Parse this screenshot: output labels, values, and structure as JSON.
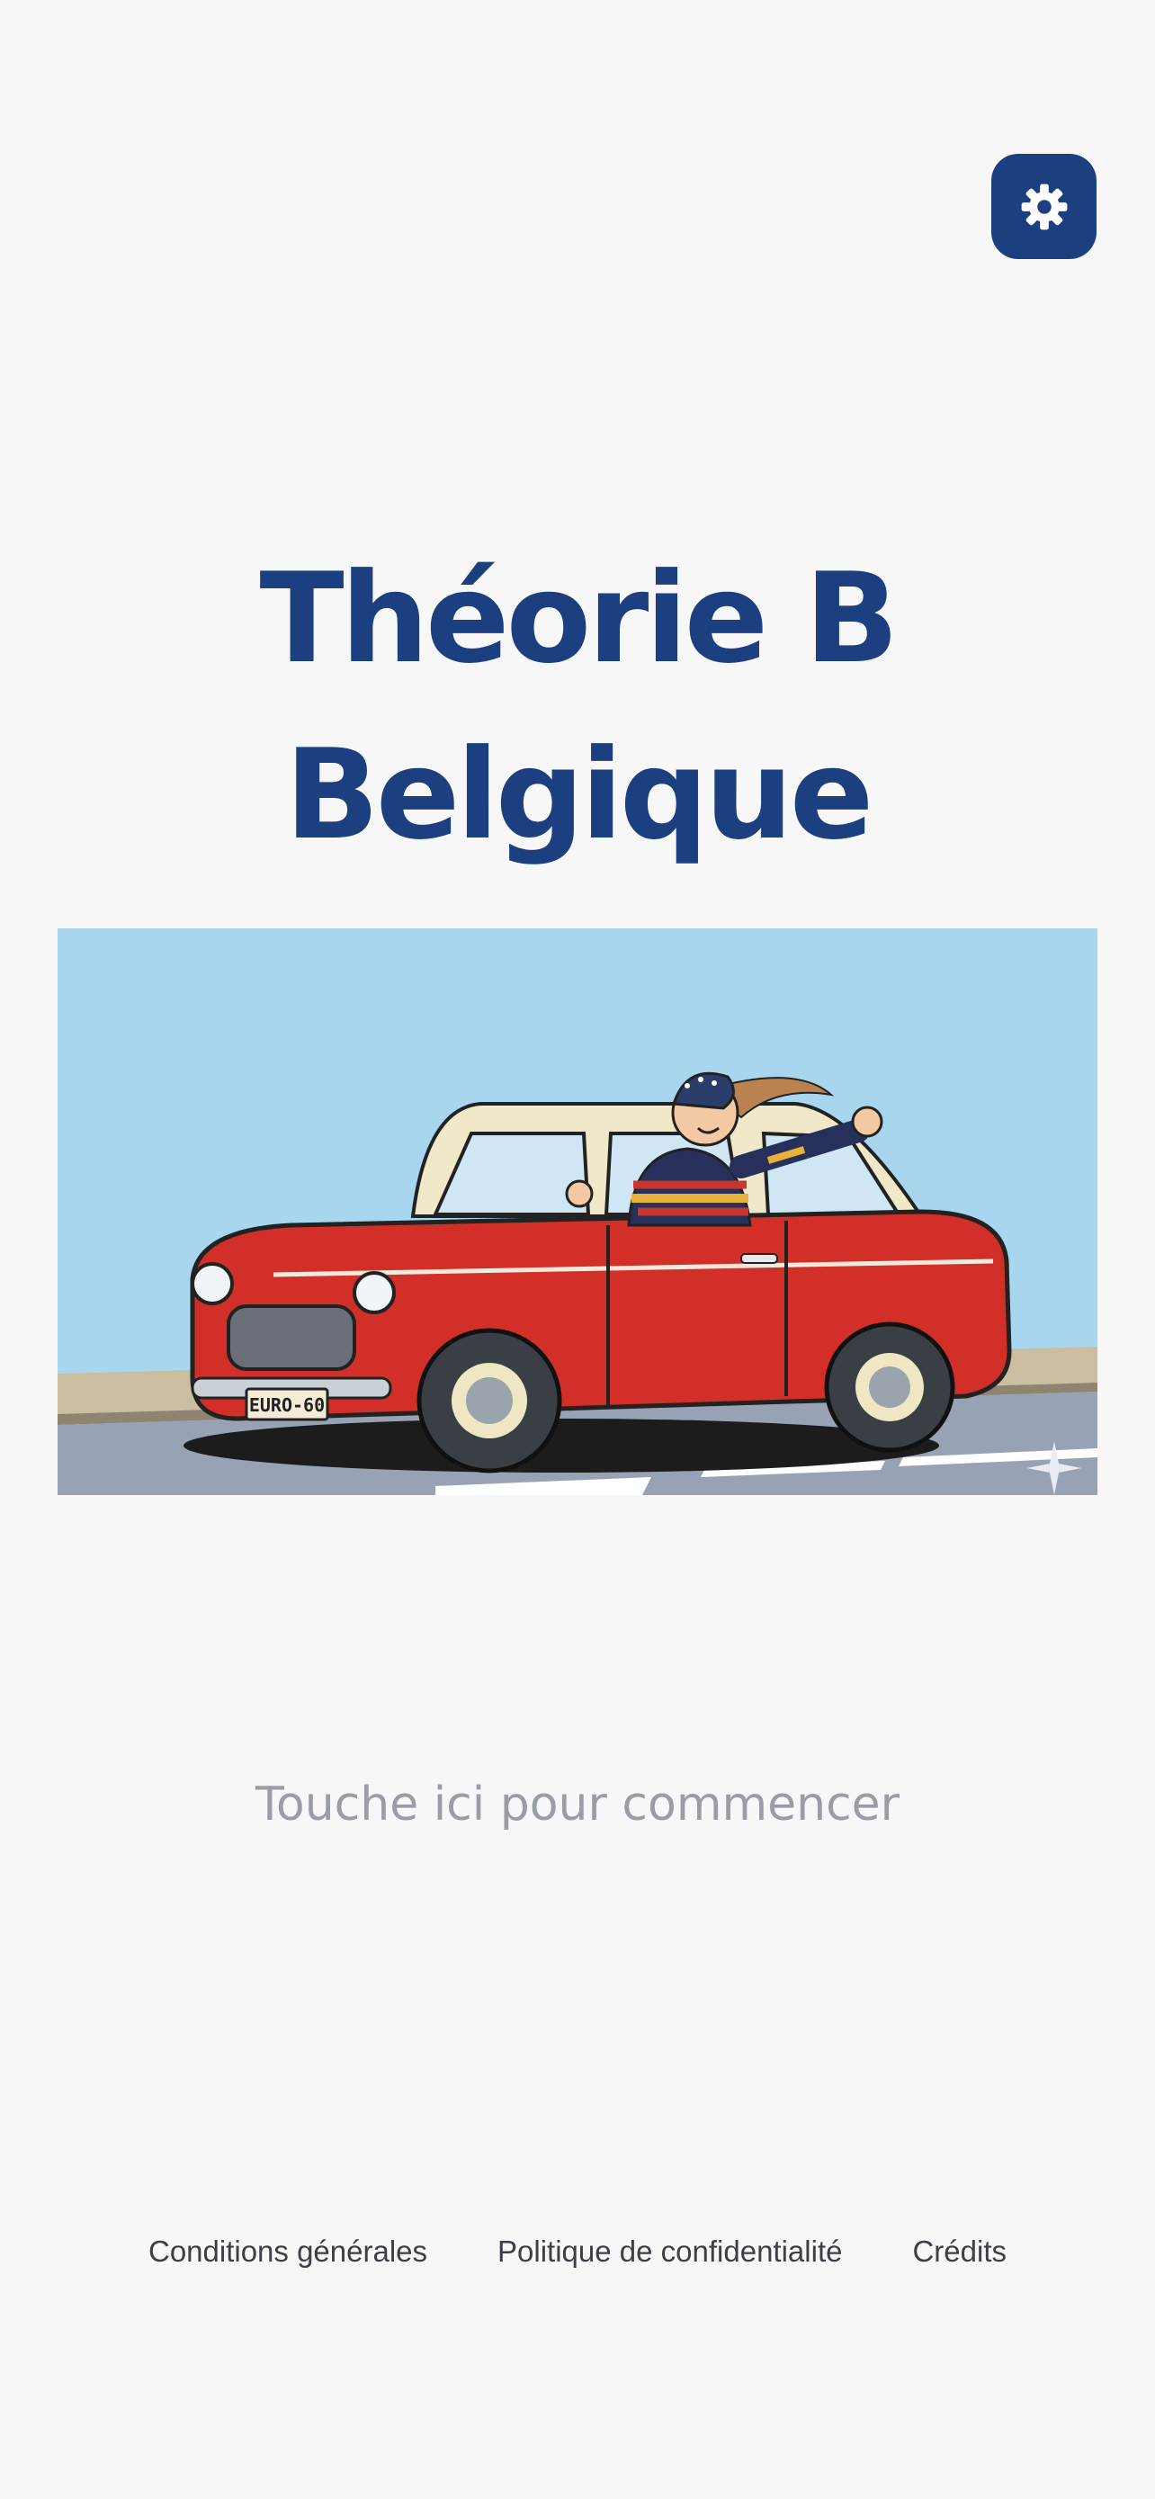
{
  "settings": {
    "icon": "gear-icon",
    "color": "#1b3f7f"
  },
  "title": {
    "line1": "Théorie B",
    "line2": "Belgique",
    "color": "#1b3f7f"
  },
  "hero": {
    "plate": "EURO-60"
  },
  "cta": {
    "label": "Touche ici pour commencer"
  },
  "footer": {
    "links": [
      "Conditions générales",
      "Politique de confidentialité",
      "Crédits"
    ]
  }
}
